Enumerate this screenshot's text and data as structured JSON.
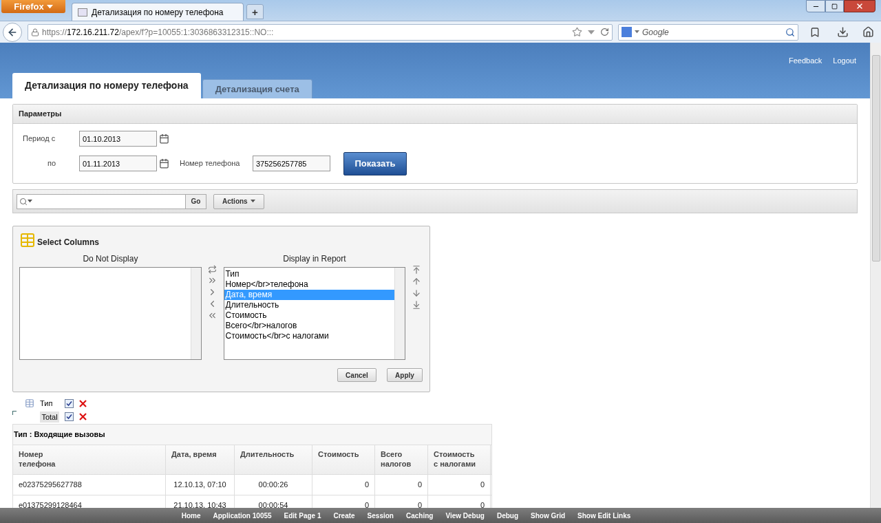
{
  "browser": {
    "menu_button": "Firefox",
    "tabs": [
      {
        "title": "Детализация по номеру телефона",
        "selected": true
      }
    ],
    "new_tab": "+",
    "url": {
      "scheme": "https://",
      "host": "172.16.211.72",
      "path": "/apex/f?p=10055:1:3036863312315::NO:::"
    },
    "search": {
      "placeholder": "Google"
    }
  },
  "header_links": [
    "Feedback",
    "Logout"
  ],
  "page_tabs": [
    {
      "label": "Детализация по номеру телефона",
      "selected": true
    },
    {
      "label": "Детализация счета",
      "selected": false
    }
  ],
  "parameters": {
    "title": "Параметры",
    "period_from": {
      "label": "Период с",
      "value": "01.10.2013"
    },
    "period_to": {
      "label": "по",
      "value": "01.11.2013"
    },
    "phone": {
      "label": "Номер телефона",
      "value": "375256257785"
    },
    "submit": "Показать"
  },
  "report_toolbar": {
    "go": "Go",
    "actions": "Actions"
  },
  "select_columns": {
    "title": "Select Columns",
    "left_heading": "Do Not Display",
    "right_heading": "Display in Report",
    "displayed": [
      {
        "label": "Тип",
        "selected": false
      },
      {
        "label": "Номер</br>телефона",
        "selected": false
      },
      {
        "label": "Дата, время",
        "selected": true
      },
      {
        "label": "Длительность",
        "selected": false
      },
      {
        "label": "Стоимость",
        "selected": false
      },
      {
        "label": "Всего</br>налогов",
        "selected": false
      },
      {
        "label": "Стоимость</br>с налогами",
        "selected": false
      }
    ],
    "cancel": "Cancel",
    "apply": "Apply"
  },
  "control_break": [
    {
      "label": "Тип",
      "checked": true
    },
    {
      "label": "Total",
      "checked": true
    }
  ],
  "report": {
    "group_title": "Тип : Входящие вызовы",
    "columns": [
      "Номер\nтелефона",
      "Дата, время",
      "Длительность",
      "Стоимость",
      "Всего\nналогов",
      "Стоимость\nс налогами"
    ],
    "rows": [
      [
        "e02375295627788",
        "12.10.13, 07:10",
        "00:00:26",
        "0",
        "0",
        "0"
      ],
      [
        "e01375299128464",
        "21.10.13, 10:43",
        "00:00:54",
        "0",
        "0",
        "0"
      ]
    ]
  },
  "developer_toolbar": [
    "Home",
    "Application 10055",
    "Edit Page 1",
    "Create",
    "Session",
    "Caching",
    "View Debug",
    "Debug",
    "Show Grid",
    "Show Edit Links"
  ]
}
